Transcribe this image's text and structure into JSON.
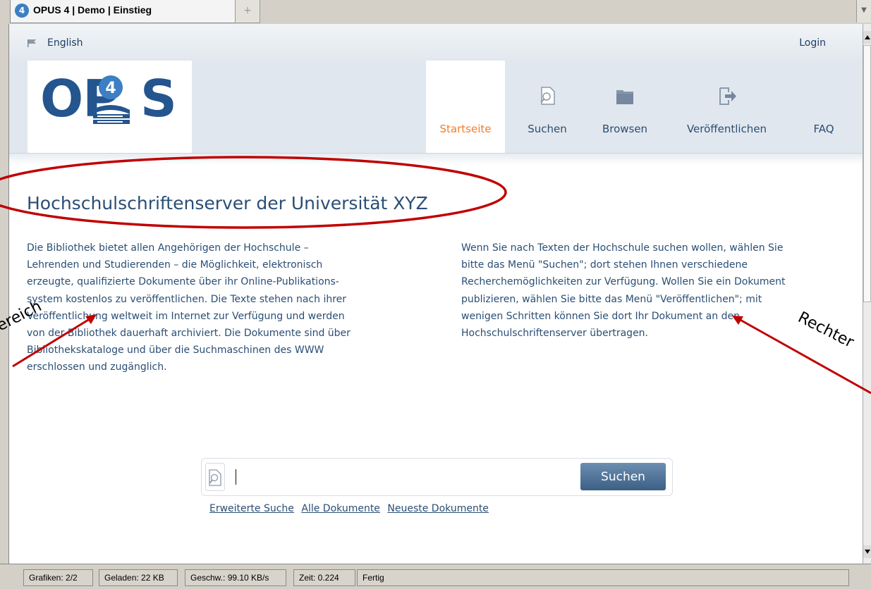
{
  "browser": {
    "tab_title": "OPUS 4 | Demo | Einstieg",
    "favicon_letter": "4",
    "new_tab_symbol": "+",
    "status_cells": [
      "Grafiken: 2/2",
      "Geladen: 22 KB",
      "Geschw.: 99.10 KB/s",
      "Zeit: 0.224",
      "Fertig"
    ]
  },
  "topbar": {
    "language": "English",
    "login": "Login"
  },
  "logo": {
    "left": "OP",
    "right": "S",
    "badge_digit": "4"
  },
  "nav": [
    {
      "label": "Startseite",
      "icon": "home",
      "active": true
    },
    {
      "label": "Suchen",
      "icon": "search-document-icon"
    },
    {
      "label": "Browsen",
      "icon": "folder-icon"
    },
    {
      "label": "Veröffentlichen",
      "icon": "export-arrow-icon"
    },
    {
      "label": "FAQ",
      "icon": ""
    }
  ],
  "main": {
    "title": "Hochschulschriftenserver der Universität XYZ",
    "left_lines": [
      "Die Bibliothek bietet allen Angehörigen der Hochschule –",
      "Lehrenden und Studierenden – die Möglichkeit, elektronisch",
      "erzeugte, qualifizierte Dokumente über ihr Online-Publikations-",
      "system kostenlos zu veröffentlichen. Die Texte stehen nach ihrer",
      "Veröffentlichung weltweit im Internet zur Verfügung und werden",
      "von der Bibliothek dauerhaft archiviert. Die Dokumente sind über",
      "Bibliothekskataloge und über die Suchmaschinen des WWW",
      "erschlossen und zugänglich."
    ],
    "right_lines": [
      "Wenn Sie nach Texten der Hochschule suchen wollen, wählen Sie",
      "bitte das Menü \"Suchen\"; dort stehen Ihnen verschiedene",
      "Recherchemöglichkeiten zur Verfügung. Wollen Sie ein Dokument",
      "publizieren, wählen Sie bitte das Menü \"Veröffentlichen\"; mit",
      "wenigen Schritten können Sie dort Ihr Dokument an den",
      "Hochschulschriftenserver übertragen."
    ]
  },
  "search": {
    "input_value": "",
    "button_label": "Suchen",
    "links": [
      "Erweiterte Suche",
      "Alle Dokumente",
      "Neueste Dokumente"
    ]
  },
  "annotations": {
    "left_label": "ereich",
    "right_label": "Rechter",
    "color": "#c00000"
  }
}
